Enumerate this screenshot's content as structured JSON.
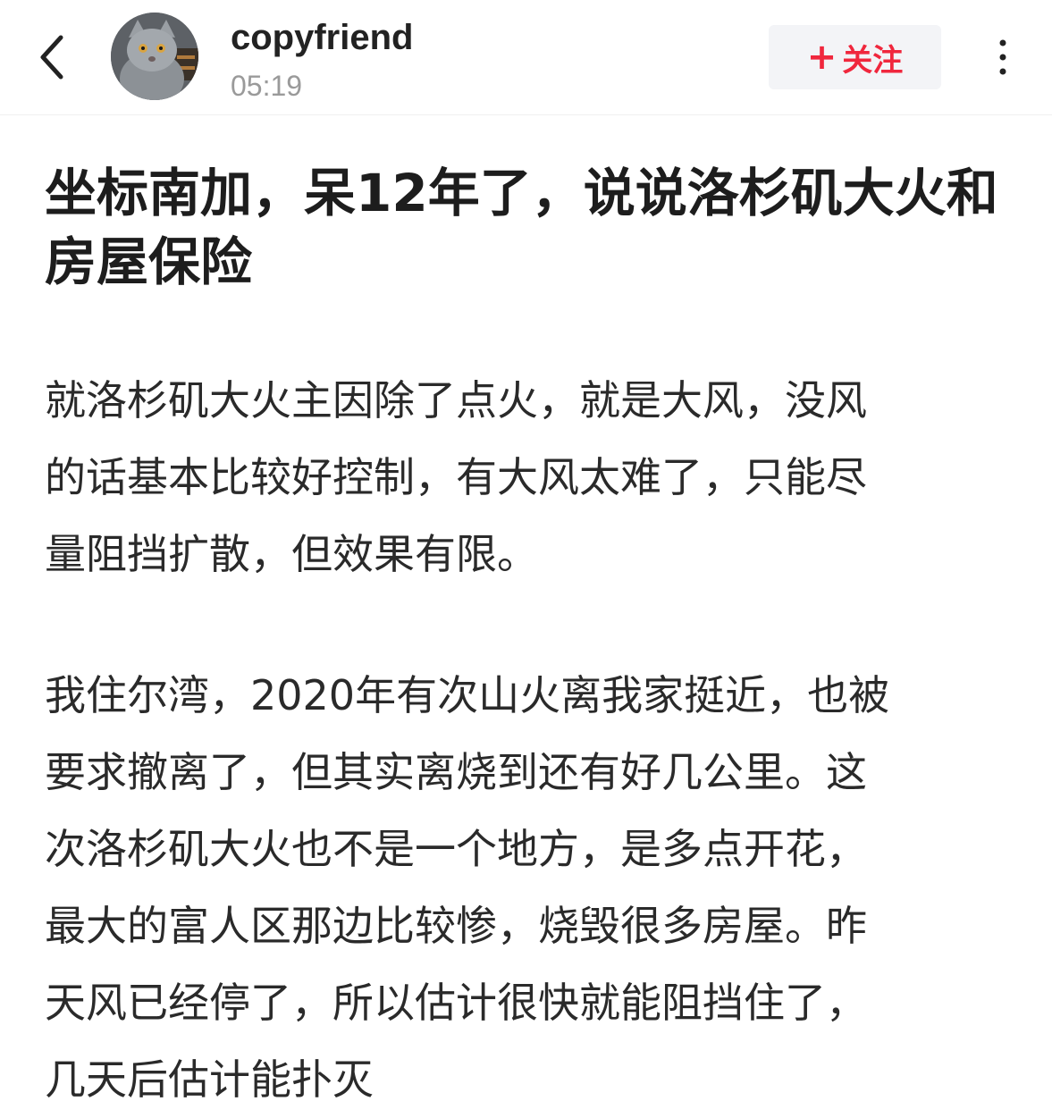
{
  "header": {
    "user_name": "copyfriend",
    "post_time": "05:19",
    "follow_plus": "+",
    "follow_label": "关注",
    "icons": {
      "back": "back-chevron-icon",
      "avatar": "cat-avatar",
      "more": "more-vertical-icon"
    }
  },
  "article": {
    "title": "坐标南加，呆12年了，说说洛杉矶大火和\n房屋保险",
    "paragraphs": [
      "就洛杉矶大火主因除了点火，就是大风，没风\n的话基本比较好控制，有大风太难了，只能尽\n量阻挡扩散，但效果有限。",
      "我住尔湾，2020年有次山火离我家挺近，也被\n要求撤离了，但其实离烧到还有好几公里。这\n次洛杉矶大火也不是一个地方，是多点开花，\n最大的富人区那边比较惨，烧毁很多房屋。昨\n天风已经停了，所以估计很快就能阻挡住了，\n几天后估计能扑灭"
    ]
  },
  "colors": {
    "follow_accent": "#f0273d",
    "follow_bg": "#f3f4f7",
    "time_gray": "#9a9a9a",
    "text_dark": "#222222"
  }
}
